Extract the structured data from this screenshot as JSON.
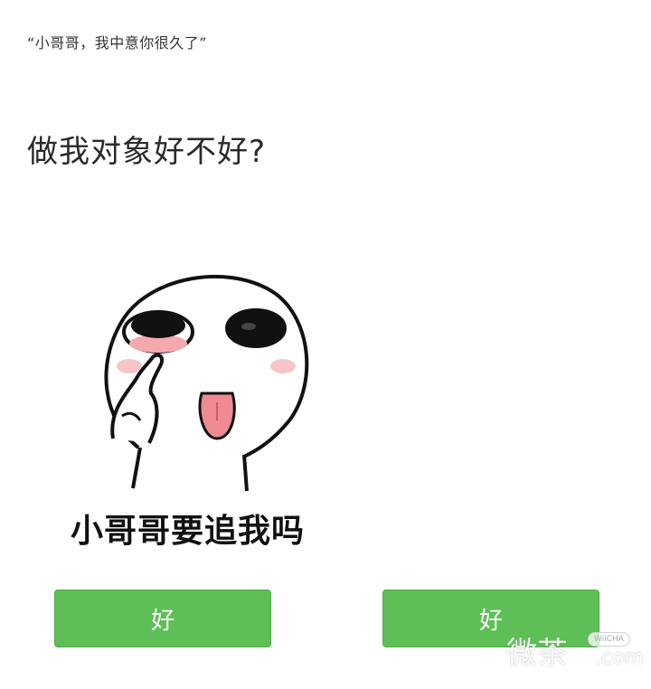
{
  "message": {
    "quote": "“小哥哥，我中意你很久了”",
    "question": "做我对象好不好?"
  },
  "sticker": {
    "caption": "小哥哥要追我吗",
    "icon": "pouting-face-sticker"
  },
  "buttons": {
    "left_label": "好",
    "right_label": "好",
    "color": "#5fbf57"
  },
  "watermark": {
    "brand": "微茶",
    "badge": "WiiCHA",
    "domain": ".com"
  }
}
